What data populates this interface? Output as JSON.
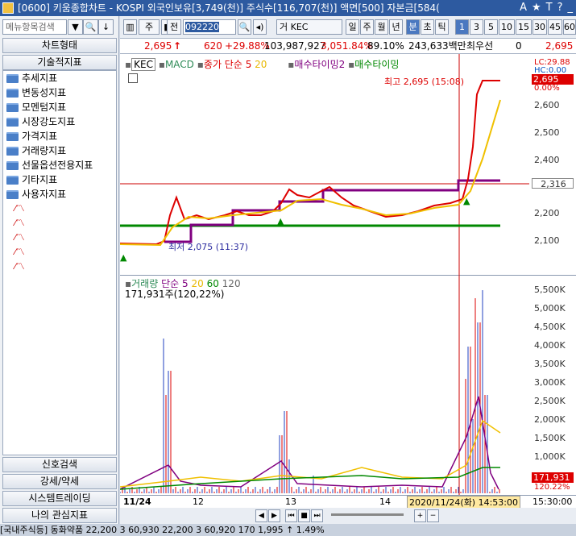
{
  "window": {
    "title": "[0600] 키움종합차트 - KOSPI 외국인보유[3,749(천)] 주식수[116,707(천)] 액면[500] 자본금[584(",
    "controls": [
      "A",
      "★",
      "T",
      "?",
      "_"
    ]
  },
  "left": {
    "search_placeholder": "메뉴항목검색",
    "tabs": [
      "차트형태",
      "기술적지표"
    ],
    "tree": [
      "추세지표",
      "변동성지표",
      "모멘텀지표",
      "시장강도지표",
      "가격지표",
      "거래량지표",
      "선물옵션전용지표",
      "기타지표",
      "사용자지표"
    ],
    "bottom": [
      "신호검색",
      "강세/약세",
      "시스템트레이딩",
      "나의 관심지표"
    ]
  },
  "toolbar": {
    "type": "주",
    "prev": "전",
    "code": "092220",
    "name": "거 KEC",
    "periods": [
      "일",
      "주",
      "월",
      "년",
      "분",
      "초",
      "틱"
    ],
    "nums": [
      "1",
      "3",
      "5",
      "10",
      "15",
      "30",
      "45",
      "60"
    ]
  },
  "info": {
    "price": "2,695",
    "arrow": "↑",
    "change": "620",
    "rate": "+29.88%",
    "volume": "103,987,927",
    "vol_rate": "3,051.84%",
    "ratio": "89.10%",
    "amount": "243,633백만",
    "label": "최우선",
    "zero": "0",
    "last": "2,695"
  },
  "chart1": {
    "legend": {
      "name": "KEC",
      "macd": "MACD",
      "close": "종가 단순 5",
      "ma20": "20",
      "t2": "매수타이밍2",
      "t1": "매수타이밍"
    },
    "high_label": "최고 2,695 (15:08)",
    "low_label": "최저 2,075 (11:37)",
    "y": [
      "2,600",
      "2,500",
      "2,400",
      "2,300",
      "2,200",
      "2,100"
    ],
    "y_values": [
      2600,
      2500,
      2400,
      2300,
      2200,
      2100
    ],
    "tags": {
      "lc": "LC:29.88",
      "hc": "HC:0.00",
      "last": "2,695",
      "pct": "0.00%",
      "cur": "2,316"
    }
  },
  "chart2": {
    "legend": {
      "name": "거래량",
      "ma": "단순 5",
      "m20": "20",
      "m60": "60",
      "m120": "120"
    },
    "sub": "171,931주(120,22%)",
    "y": [
      "5,500K",
      "5,000K",
      "4,500K",
      "4,000K",
      "3,500K",
      "3,000K",
      "2,500K",
      "2,000K",
      "1,500K",
      "1,000K",
      "500,000"
    ],
    "y_values": [
      5500,
      5000,
      4500,
      4000,
      3500,
      3000,
      2500,
      2000,
      1500,
      1000,
      500
    ],
    "tags": {
      "last": "171,931",
      "pct": "120.22%"
    }
  },
  "xaxis": {
    "labels": [
      "11/24",
      "12",
      "13",
      "14"
    ],
    "cursor": "2020/11/24(화) 14:53:00",
    "time": "15:30:00"
  },
  "bottom": {
    "text": "[국내주식등] 동화약품 22,200 3 60,930 22,200 3 60,920 170 1,995 ↑ 1.49%"
  },
  "chart_data": {
    "type": "line",
    "series": [
      {
        "name": "KEC",
        "values": []
      }
    ]
  }
}
